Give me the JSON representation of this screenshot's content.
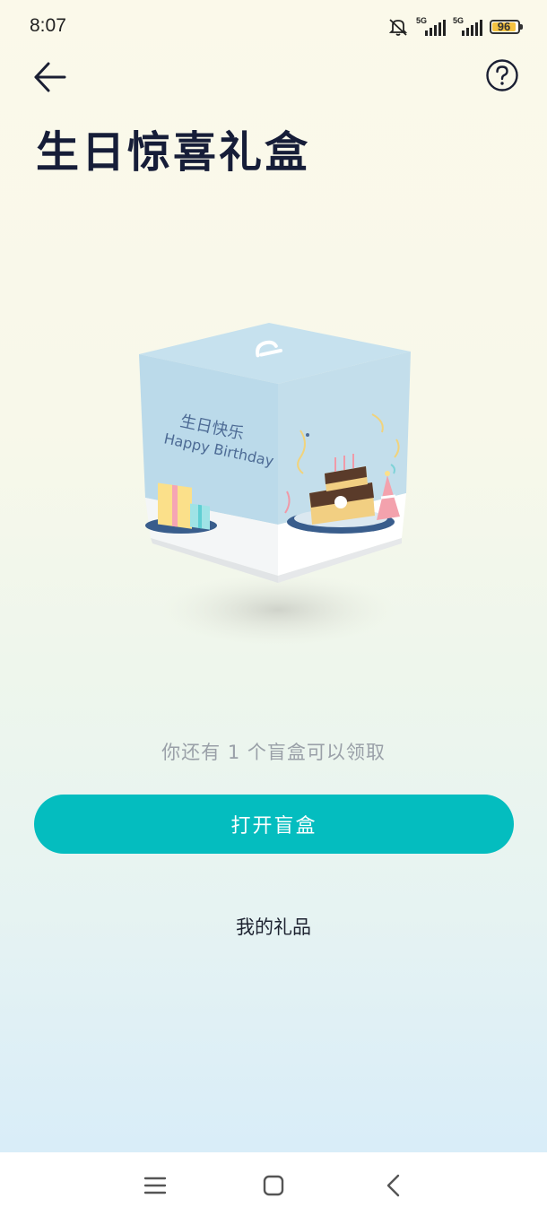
{
  "status_bar": {
    "time": "8:07",
    "network_1": "5G",
    "network_2": "5G",
    "battery": "96",
    "icons": [
      "mute-icon",
      "signal-icon",
      "signal-icon",
      "battery-icon"
    ]
  },
  "header": {
    "back_icon": "arrow-left-icon",
    "help_icon": "question-circle-icon",
    "title": "生日惊喜礼盒"
  },
  "gift_box": {
    "label_cn": "生日快乐",
    "label_en": "Happy Birthday"
  },
  "main": {
    "remaining_text": "你还有 1 个盲盒可以领取",
    "open_button": "打开盲盒",
    "my_gifts_link": "我的礼品"
  },
  "colors": {
    "accent": "#04bdbf",
    "title": "#161d38",
    "hint": "#9aa0a8"
  },
  "nav_bar": {
    "icons": [
      "menu-icon",
      "home-icon",
      "back-icon"
    ]
  }
}
